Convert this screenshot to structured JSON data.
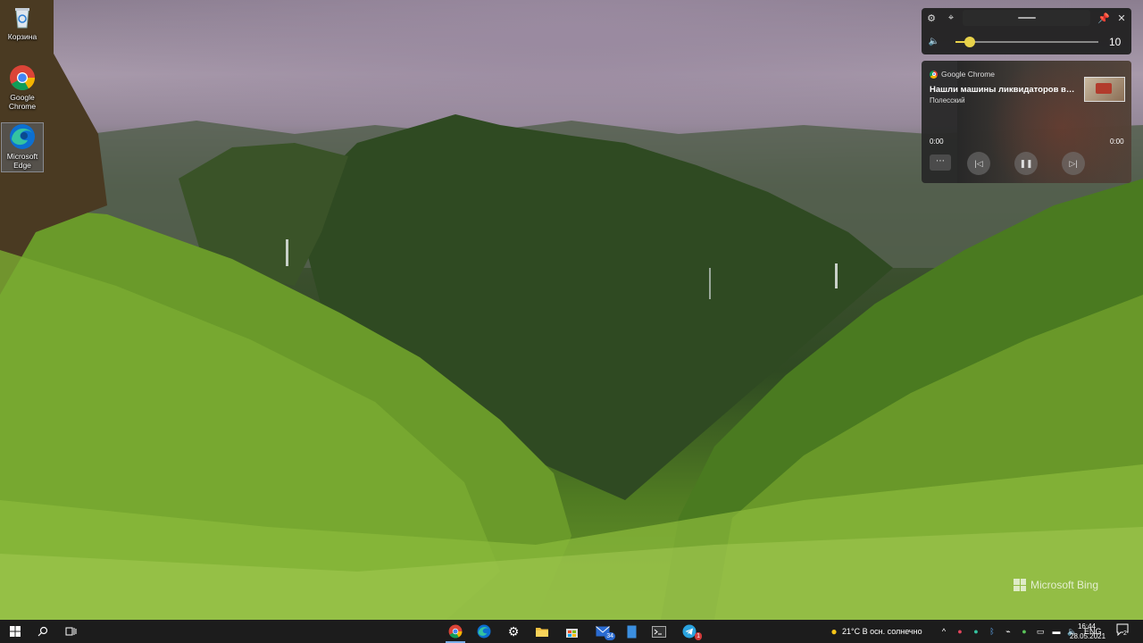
{
  "desktop": {
    "icons": [
      {
        "label": "Корзина"
      },
      {
        "label": "Google Chrome"
      },
      {
        "label": "Microsoft Edge"
      }
    ],
    "watermark": "Microsoft Bing"
  },
  "volume_flyout": {
    "value": "10",
    "level_percent": 10,
    "accent_color": "#e8d24a"
  },
  "media": {
    "app_name": "Google Chrome",
    "title": "Нашли машины ликвидаторов в Припяти",
    "artist": "Полесский",
    "time_elapsed": "0:00",
    "time_total": "0:00"
  },
  "taskbar": {
    "weather": "21°C  В осн. солнечно",
    "language": "ENG",
    "time": "16:44",
    "date": "28.05.2021",
    "notification_count": "2",
    "mail_badge": "34",
    "telegram_badge": "1"
  }
}
